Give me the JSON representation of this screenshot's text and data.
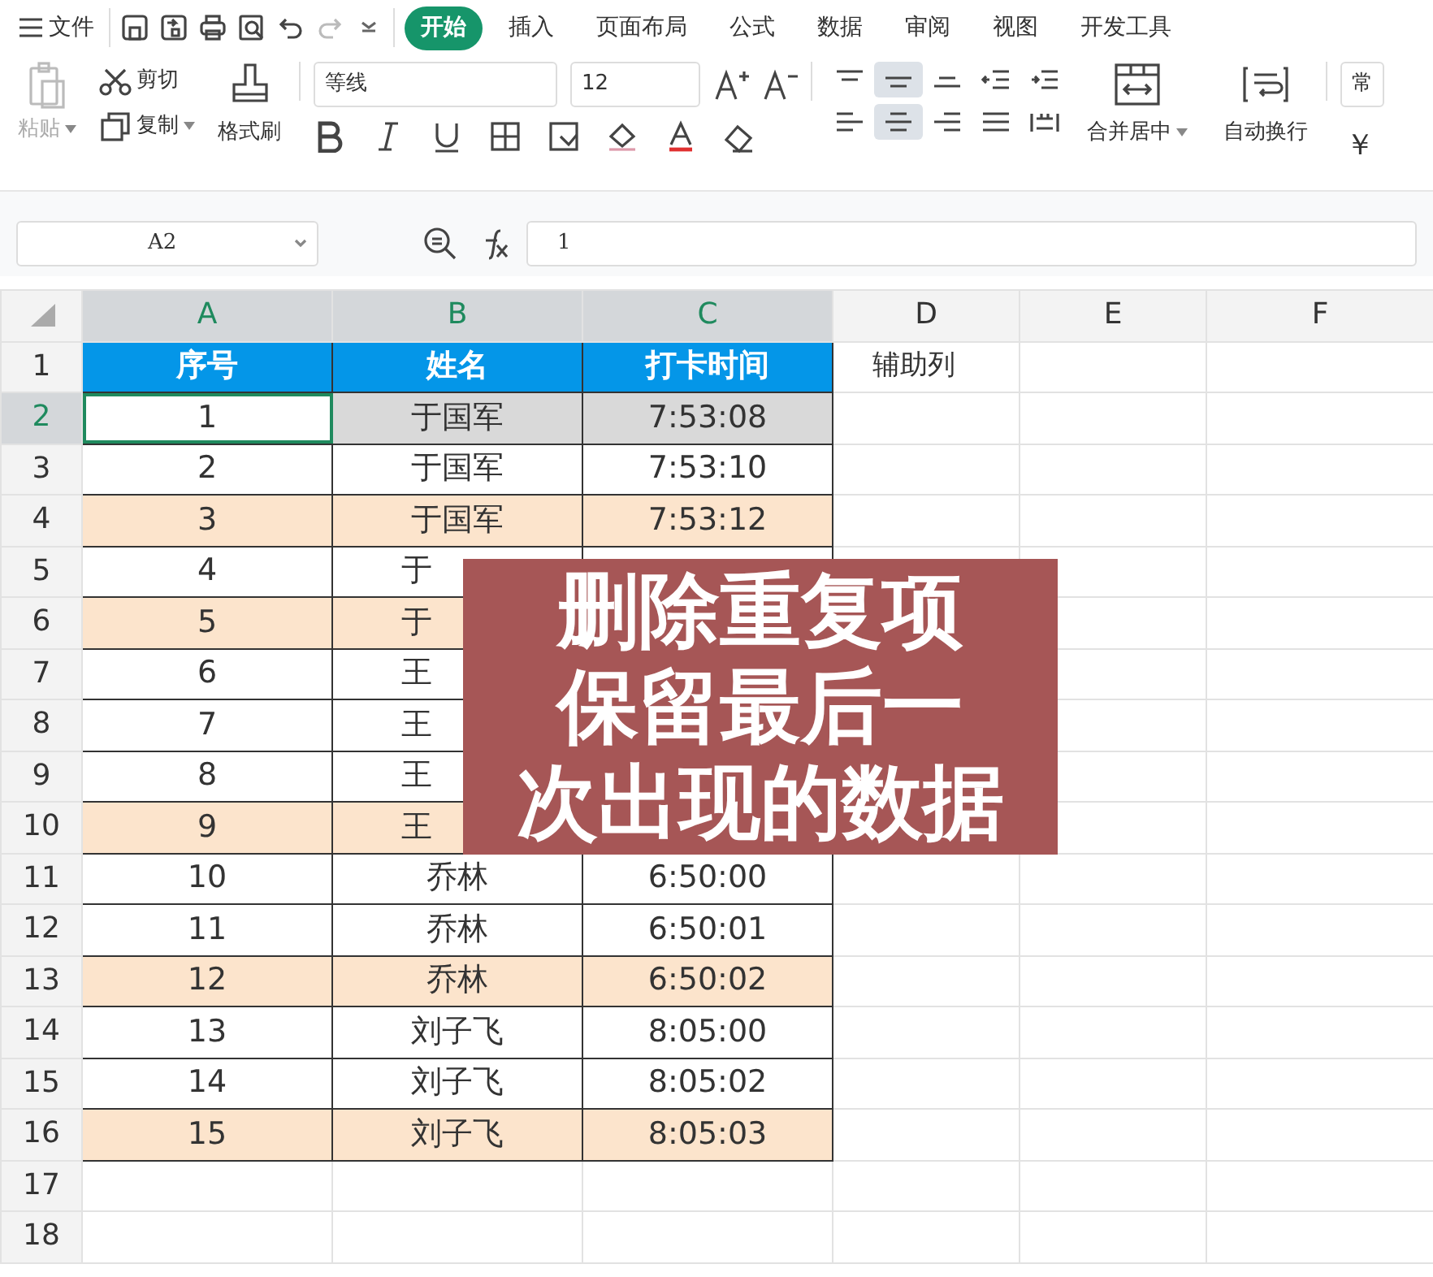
{
  "menu": {
    "label": "文件"
  },
  "tabs": [
    {
      "label": "开始",
      "selected": true
    },
    {
      "label": "插入",
      "selected": false
    },
    {
      "label": "页面布局",
      "selected": false
    },
    {
      "label": "公式",
      "selected": false
    },
    {
      "label": "数据",
      "selected": false
    },
    {
      "label": "审阅",
      "selected": false
    },
    {
      "label": "视图",
      "selected": false
    },
    {
      "label": "开发工具",
      "selected": false
    }
  ],
  "clipboard": {
    "paste": "粘贴",
    "cut": "剪切",
    "copy": "复制",
    "format_painter": "格式刷"
  },
  "font": {
    "name": "等线",
    "size": "12"
  },
  "align_buttons": [
    {
      "kind": "top",
      "selected": false
    },
    {
      "kind": "middle",
      "selected": true
    },
    {
      "kind": "bottom",
      "selected": false
    },
    {
      "kind": "outdent",
      "selected": false
    },
    {
      "kind": "indent",
      "selected": false
    },
    {
      "kind": "left",
      "selected": false
    },
    {
      "kind": "center",
      "selected": true
    },
    {
      "kind": "right",
      "selected": false
    },
    {
      "kind": "justify",
      "selected": false
    },
    {
      "kind": "distributed",
      "selected": false
    }
  ],
  "alignment": {
    "merge": "合并居中",
    "wrap": "自动换行"
  },
  "number_format": {
    "value": "常",
    "currency": "￥"
  },
  "formula_bar": {
    "cell_ref": "A2",
    "value": "1"
  },
  "sheet": {
    "columns": [
      {
        "label": "A",
        "selected": true
      },
      {
        "label": "B",
        "selected": true
      },
      {
        "label": "C",
        "selected": true
      },
      {
        "label": "D",
        "selected": false
      },
      {
        "label": "E",
        "selected": false
      },
      {
        "label": "F",
        "selected": false
      }
    ],
    "rows": [
      {
        "number": "1",
        "kind": "header",
        "selected": false,
        "cells": [
          "序号",
          "姓名",
          "打卡时间",
          "辅助列"
        ]
      },
      {
        "number": "2",
        "kind": "data",
        "selected": true,
        "highlighted": false,
        "cells": [
          "1",
          "于国军",
          "7:53:08"
        ]
      },
      {
        "number": "3",
        "kind": "data",
        "selected": false,
        "highlighted": false,
        "cells": [
          "2",
          "于国军",
          "7:53:10"
        ]
      },
      {
        "number": "4",
        "kind": "data",
        "selected": false,
        "highlighted": true,
        "cells": [
          "3",
          "于国军",
          "7:53:12"
        ]
      },
      {
        "number": "5",
        "kind": "data",
        "selected": false,
        "highlighted": false,
        "name_cut": true,
        "cells": [
          "4",
          "于"
        ]
      },
      {
        "number": "6",
        "kind": "data",
        "selected": false,
        "highlighted": true,
        "name_cut": true,
        "cells": [
          "5",
          "于"
        ]
      },
      {
        "number": "7",
        "kind": "data",
        "selected": false,
        "highlighted": false,
        "name_cut": true,
        "cells": [
          "6",
          "王"
        ]
      },
      {
        "number": "8",
        "kind": "data",
        "selected": false,
        "highlighted": false,
        "name_cut": true,
        "cells": [
          "7",
          "王"
        ]
      },
      {
        "number": "9",
        "kind": "data",
        "selected": false,
        "highlighted": false,
        "name_cut": true,
        "cells": [
          "8",
          "王"
        ]
      },
      {
        "number": "10",
        "kind": "data",
        "selected": false,
        "highlighted": true,
        "name_cut": true,
        "cells": [
          "9",
          "王"
        ]
      },
      {
        "number": "11",
        "kind": "data",
        "selected": false,
        "highlighted": false,
        "cells": [
          "10",
          "乔林",
          "6:50:00"
        ]
      },
      {
        "number": "12",
        "kind": "data",
        "selected": false,
        "highlighted": false,
        "cells": [
          "11",
          "乔林",
          "6:50:01"
        ]
      },
      {
        "number": "13",
        "kind": "data",
        "selected": false,
        "highlighted": true,
        "cells": [
          "12",
          "乔林",
          "6:50:02"
        ]
      },
      {
        "number": "14",
        "kind": "data",
        "selected": false,
        "highlighted": false,
        "cells": [
          "13",
          "刘子飞",
          "8:05:00"
        ]
      },
      {
        "number": "15",
        "kind": "data",
        "selected": false,
        "highlighted": false,
        "cells": [
          "14",
          "刘子飞",
          "8:05:02"
        ]
      },
      {
        "number": "16",
        "kind": "data",
        "selected": false,
        "highlighted": true,
        "cells": [
          "15",
          "刘子飞",
          "8:05:03"
        ]
      },
      {
        "number": "17",
        "kind": "empty",
        "selected": false,
        "cells": []
      },
      {
        "number": "18",
        "kind": "empty",
        "selected": false,
        "cells": []
      }
    ]
  },
  "overlay": {
    "lines": [
      "删除重复项",
      "保留最后一",
      "次出现的数据"
    ]
  }
}
